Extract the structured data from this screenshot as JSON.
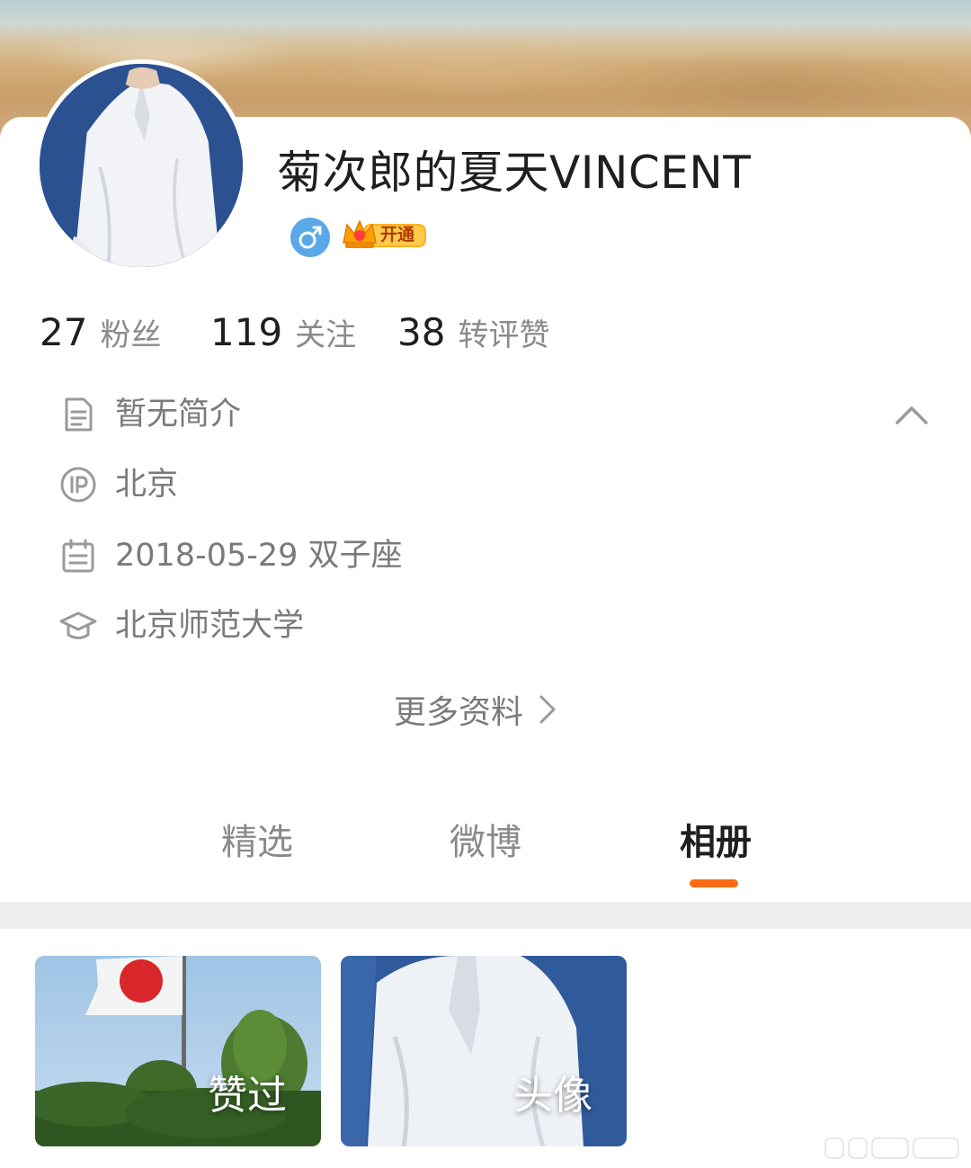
{
  "profile": {
    "name": "菊次郎的夏天VINCENT",
    "vip_badge_text": "开通",
    "gender_symbol": "♂"
  },
  "stats": {
    "followers": {
      "count": "27",
      "label": "粉丝"
    },
    "following": {
      "count": "119",
      "label": "关注"
    },
    "interactions": {
      "count": "38",
      "label": "转评赞"
    }
  },
  "info": {
    "bio": "暂无简介",
    "ip_location": "北京",
    "birthday": "2018-05-29 双子座",
    "school": "北京师范大学",
    "more_label": "更多资料"
  },
  "tabs": [
    {
      "label": "精选",
      "active": false
    },
    {
      "label": "微博",
      "active": false
    },
    {
      "label": "相册",
      "active": true
    }
  ],
  "album": [
    {
      "label": "赞过"
    },
    {
      "label": "头像"
    }
  ],
  "colors": {
    "accent": "#ff6a13",
    "gender_badge": "#5aa8e8",
    "primary_text": "#1f1f1f",
    "secondary_text": "#8a8a8a"
  },
  "icons": {
    "bio": "document-icon",
    "ip": "ip-location-icon",
    "birthday": "calendar-icon",
    "school": "graduation-cap-icon",
    "collapse": "chevron-up-icon",
    "more": "chevron-right-icon"
  }
}
